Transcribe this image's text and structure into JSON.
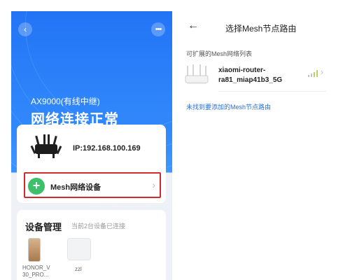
{
  "left_screen": {
    "model": "AX9000(有线中继)",
    "status": "网络连接正常",
    "ip": "IP:192.168.100.169",
    "mesh_button_label": "Mesh网络设备",
    "devices": {
      "title": "设备管理",
      "subtitle": "当前2台设备已连接",
      "items": [
        {
          "name": "HONOR_V 30_PRO...",
          "icon": "phone-icon"
        },
        {
          "name": "zzl",
          "icon": "device-box-icon"
        }
      ]
    },
    "icons": {
      "back": "back-icon",
      "more": "more-icon",
      "plus": "plus-icon",
      "chevron": "chevron-right-icon"
    }
  },
  "right_screen": {
    "title": "选择Mesh节点路由",
    "section_label": "可扩展的Mesh网络列表",
    "node": {
      "name": "xiaomi-router-ra81_miap41b3_5G"
    },
    "link_text": "未找到要添加的Mesh节点路由",
    "icons": {
      "back": "back-arrow-icon",
      "signal": "signal-icon",
      "chevron": "chevron-right-icon"
    }
  },
  "colors": {
    "header_blue": "#1b6ff5",
    "accent_green": "#3ec06a",
    "highlight_red": "#d12a2a",
    "link_blue": "#2a6fd6"
  }
}
